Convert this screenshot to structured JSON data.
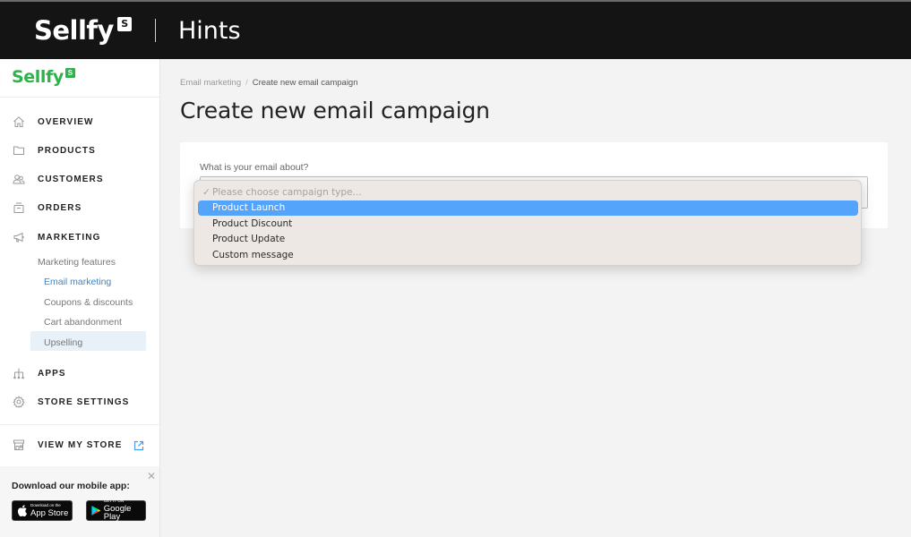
{
  "topbar": {
    "brand": "Sellfy",
    "brand_badge": "S",
    "title": "Hints"
  },
  "sidebar": {
    "brand": "Sellfy",
    "brand_badge": "S",
    "nav": [
      {
        "label": "OVERVIEW",
        "icon": "home-icon"
      },
      {
        "label": "PRODUCTS",
        "icon": "folder-icon"
      },
      {
        "label": "CUSTOMERS",
        "icon": "users-icon"
      },
      {
        "label": "ORDERS",
        "icon": "basket-icon"
      },
      {
        "label": "MARKETING",
        "icon": "megaphone-icon"
      },
      {
        "label": "APPS",
        "icon": "apps-icon"
      },
      {
        "label": "STORE SETTINGS",
        "icon": "gear-icon"
      },
      {
        "label": "VIEW MY STORE",
        "icon": "storefront-icon"
      }
    ],
    "marketing_sub": {
      "header": "Marketing features",
      "items": [
        "Email marketing",
        "Coupons & discounts",
        "Cart abandonment",
        "Upselling"
      ],
      "active": "Email marketing"
    },
    "mobile_app": {
      "title": "Download our mobile app:",
      "app_store": {
        "small": "Download on the",
        "big": "App Store"
      },
      "google_play": {
        "small": "GET IT ON",
        "big": "Google Play"
      }
    }
  },
  "main": {
    "breadcrumb": {
      "parent": "Email marketing",
      "separator": "/",
      "current": "Create new email campaign"
    },
    "title": "Create new email campaign",
    "form": {
      "label": "What is your email about?",
      "select": {
        "placeholder": "Please choose campaign type...",
        "options": [
          "Product Launch",
          "Product Discount",
          "Product Update",
          "Custom message"
        ],
        "highlighted": "Product Launch"
      }
    }
  },
  "colors": {
    "brand_green": "#2db34a",
    "highlight_blue": "#55a4fb",
    "link_blue": "#4a9be3",
    "topbar_bg": "#141414"
  }
}
